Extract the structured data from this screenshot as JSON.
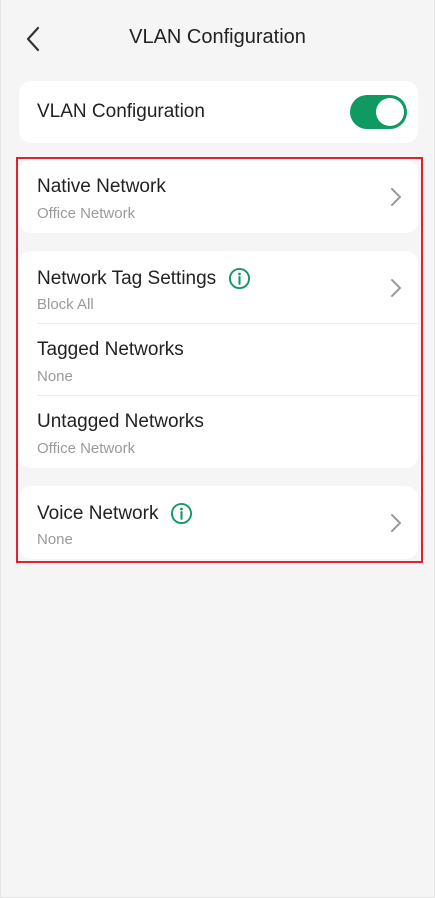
{
  "header": {
    "title": "VLAN Configuration",
    "back_icon": "chevron-left-icon"
  },
  "vlan_toggle": {
    "label": "VLAN Configuration",
    "enabled": true,
    "accent_color": "#0e9a61"
  },
  "native_network": {
    "title": "Native Network",
    "value": "Office Network"
  },
  "network_tag_settings": {
    "title": "Network Tag Settings",
    "value": "Block All"
  },
  "tagged_networks": {
    "title": "Tagged Networks",
    "value": "None"
  },
  "untagged_networks": {
    "title": "Untagged Networks",
    "value": "Office Network"
  },
  "voice_network": {
    "title": "Voice Network",
    "value": "None"
  },
  "colors": {
    "background": "#f5f5f5",
    "highlight_border": "#e0212f",
    "secondary_text": "#9a9a9a"
  }
}
